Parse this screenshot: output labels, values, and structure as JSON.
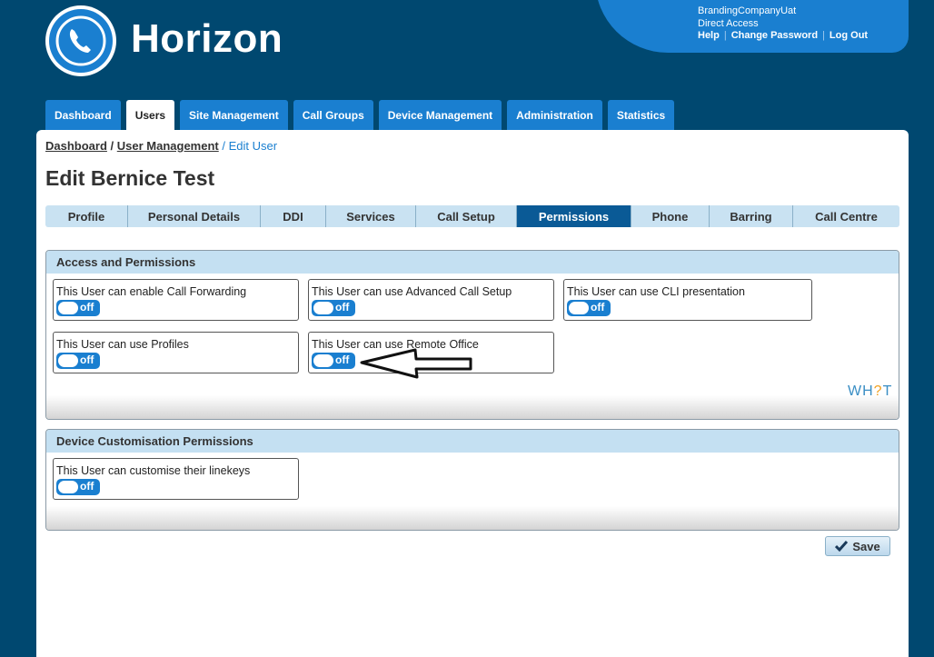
{
  "brand": {
    "name": "Horizon",
    "logo_icon": "phone-icon"
  },
  "account": {
    "company": "BrandingCompanyUat",
    "access": "Direct Access",
    "links": {
      "help": "Help",
      "change_password": "Change Password",
      "logout": "Log Out"
    }
  },
  "nav": {
    "tabs": [
      {
        "label": "Dashboard"
      },
      {
        "label": "Users",
        "active": true
      },
      {
        "label": "Site Management"
      },
      {
        "label": "Call Groups"
      },
      {
        "label": "Device Management"
      },
      {
        "label": "Administration"
      },
      {
        "label": "Statistics"
      }
    ]
  },
  "breadcrumb": {
    "dashboard": "Dashboard",
    "sep1": " / ",
    "user_management": "User Management",
    "sep2": " / ",
    "current": "Edit User"
  },
  "page": {
    "title": "Edit Bernice Test"
  },
  "subtabs": [
    {
      "label": "Profile"
    },
    {
      "label": "Personal Details"
    },
    {
      "label": "DDI"
    },
    {
      "label": "Services"
    },
    {
      "label": "Call Setup"
    },
    {
      "label": "Permissions",
      "active": true
    },
    {
      "label": "Phone"
    },
    {
      "label": "Barring"
    },
    {
      "label": "Call Centre"
    }
  ],
  "access_section": {
    "title": "Access and Permissions",
    "permissions": [
      {
        "label": "This User can enable Call Forwarding",
        "state": "off"
      },
      {
        "label": "This User can use Advanced Call Setup",
        "state": "off"
      },
      {
        "label": "This User can use CLI presentation",
        "state": "off"
      },
      {
        "label": "This User can use Profiles",
        "state": "off"
      },
      {
        "label": "This User can use Remote Office",
        "state": "off"
      }
    ]
  },
  "device_section": {
    "title": "Device Customisation Permissions",
    "permissions": [
      {
        "label": "This User can customise their linekeys",
        "state": "off"
      }
    ]
  },
  "watermark": {
    "part1": "WH",
    "part2": "?",
    "part3": "T"
  },
  "save": {
    "label": "Save",
    "icon": "checkmark-icon"
  },
  "colors": {
    "background": "#004870",
    "accent": "#1a7fd0",
    "active_subtab": "#0a5a96",
    "section_header": "#c4e0f2"
  }
}
